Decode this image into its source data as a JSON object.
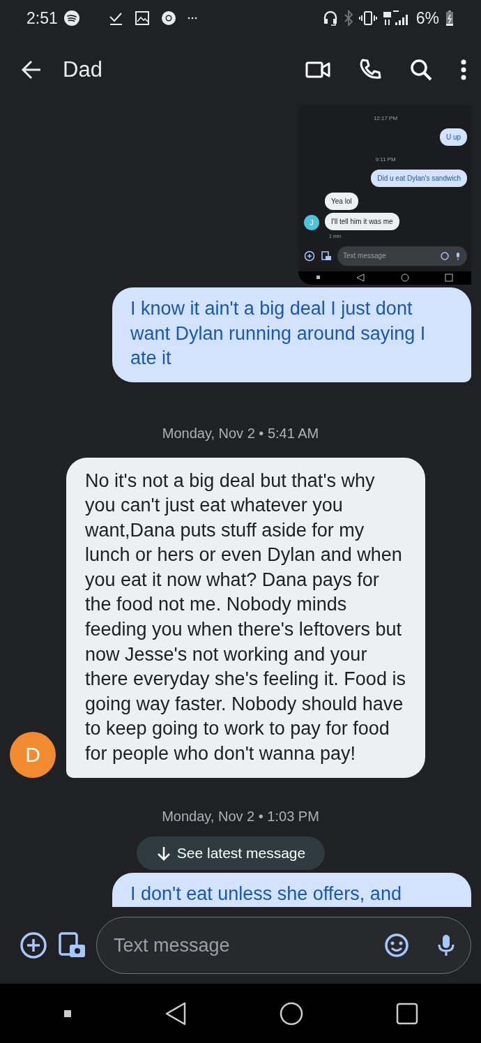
{
  "status_bar": {
    "time": "2:51",
    "battery": "6%"
  },
  "header": {
    "title": "Dad"
  },
  "messages": [
    {
      "kind": "image",
      "shot": {
        "messages": [
          {
            "kind": "time",
            "text": "12:17 PM"
          },
          {
            "kind": "sent",
            "text": "U up"
          },
          {
            "kind": "time",
            "text": "9:11 PM"
          },
          {
            "kind": "sent",
            "text": "Did u eat Dylan's sandwich"
          },
          {
            "kind": "received",
            "text": "Yea lol"
          },
          {
            "kind": "received",
            "text": "I'll tell him it was me",
            "avatar": "J"
          },
          {
            "kind": "meta",
            "text": "1 min"
          }
        ],
        "compose": {
          "placeholder": "Text message"
        }
      }
    },
    {
      "kind": "sent",
      "text": "I know it ain't a big deal I just dont want Dylan running around saying I ate it"
    },
    {
      "kind": "time",
      "text": "Monday, Nov 2 • 5:41 AM"
    },
    {
      "kind": "received",
      "text": "No it's not a big deal but that's why you can't just eat whatever you want,Dana puts stuff aside for my lunch or hers or even Dylan and when you eat it now what? Dana pays for the food not me. Nobody minds feeding you when there's leftovers but now Jesse's not working and your there everyday she's feeling it. Food is going way faster. Nobody should have to keep going to work to pay for food for people who don't wanna pay!",
      "avatar": "D"
    },
    {
      "kind": "time",
      "text": "Monday, Nov 2 • 1:03 PM"
    },
    {
      "kind": "sent",
      "text": "I don't eat unless she offers, and"
    }
  ],
  "jump_button": {
    "label": "See latest message"
  },
  "compose": {
    "placeholder": "Text message"
  }
}
